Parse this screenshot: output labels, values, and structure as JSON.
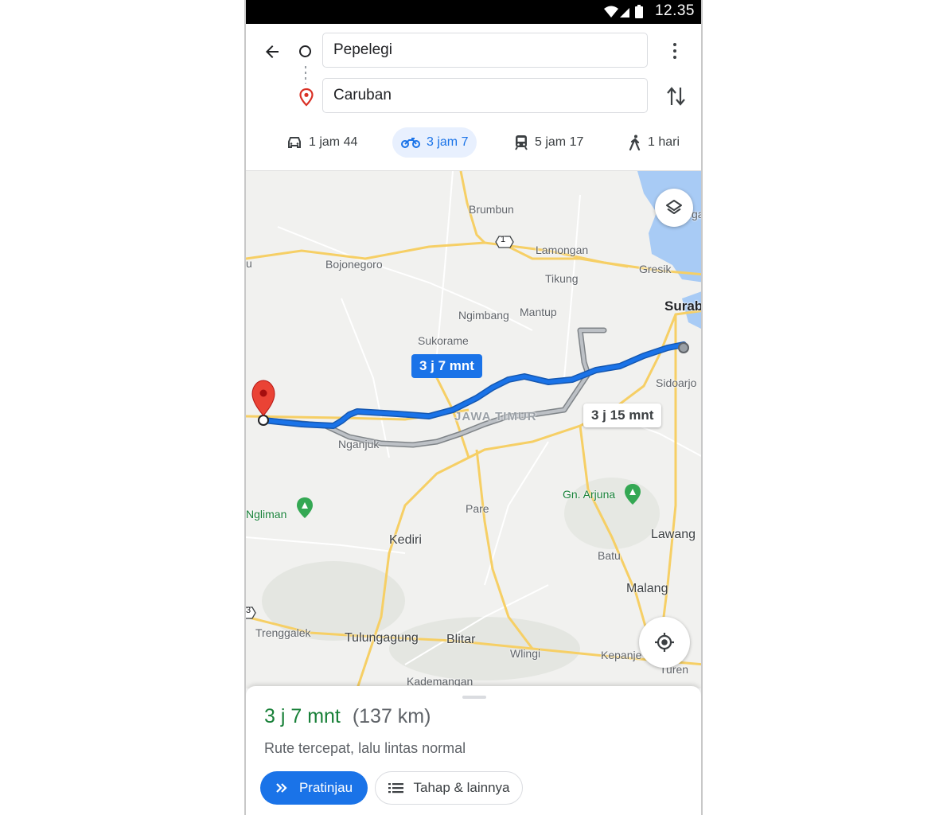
{
  "status_bar": {
    "time": "12.35"
  },
  "directions": {
    "origin": "Pepelegi",
    "destination": "Caruban"
  },
  "travel_modes": [
    {
      "mode": "car",
      "icon": "car-icon",
      "label": "1 jam 44"
    },
    {
      "mode": "motorcycle",
      "icon": "motorcycle-icon",
      "label": "3 jam 7",
      "selected": true
    },
    {
      "mode": "transit",
      "icon": "train-icon",
      "label": "5 jam 17"
    },
    {
      "mode": "walk",
      "icon": "walk-icon",
      "label": "1 hari"
    }
  ],
  "map": {
    "labels": {
      "brumbun": "Brumbun",
      "lamongan": "Lamongan",
      "bojonegoro": "Bojonegoro",
      "tikung": "Tikung",
      "gresik": "Gresik",
      "surabaya": "Surab",
      "ngimbang": "Ngimbang",
      "mantup": "Mantup",
      "sukorame": "Sukorame",
      "sidoarjo": "Sidoarjo",
      "jawa_timur": "JAWA TIMUR",
      "nganjuk": "Nganjuk",
      "gn_arjuna": "Gn. Arjuna",
      "ngliman": "Ngliman",
      "pare": "Pare",
      "kediri": "Kediri",
      "lawang": "Lawang",
      "batu": "Batu",
      "malang": "Malang",
      "trenggalek": "Trenggalek",
      "tulungagung": "Tulungagung",
      "blitar": "Blitar",
      "wlingi": "Wlingi",
      "kepanjen": "Kepanje",
      "turen": "Turen",
      "kademangan": "Kademangan",
      "edge_u": "u",
      "edge_gal": "gal",
      "road_1": "1",
      "road_3": "3"
    },
    "route_main_label": "3 j 7 mnt",
    "route_alt_label": "3 j 15 mnt"
  },
  "route_summary": {
    "duration": "3 j 7 mnt",
    "distance": "(137 km)",
    "description": "Rute tercepat, lalu lintas normal",
    "preview_button": "Pratinjau",
    "steps_button": "Tahap & lainnya"
  },
  "colors": {
    "route_blue": "#1a73e8",
    "route_alt": "#9aa0a6",
    "duration_green": "#188038",
    "road_yellow": "#f6cf65",
    "water": "#a8cbf5"
  }
}
